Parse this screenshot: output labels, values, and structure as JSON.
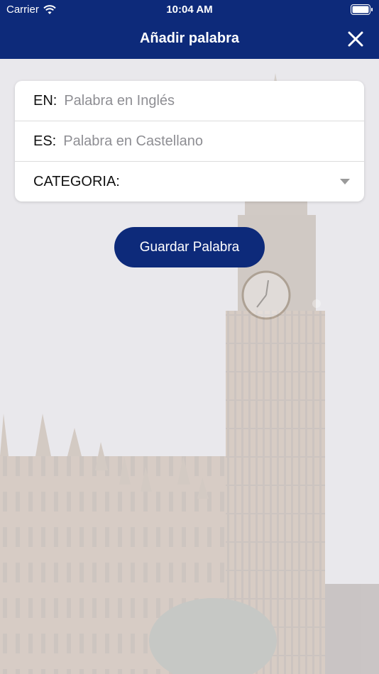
{
  "status_bar": {
    "carrier": "Carrier",
    "time": "10:04 AM",
    "wifi_icon": "wifi-icon",
    "battery_icon": "battery-icon"
  },
  "nav": {
    "title": "Añadir palabra",
    "close_icon": "close-icon"
  },
  "form": {
    "en": {
      "label": "EN:",
      "placeholder": "Palabra en Inglés",
      "value": ""
    },
    "es": {
      "label": "ES:",
      "placeholder": "Palabra en Castellano",
      "value": ""
    },
    "category": {
      "label": "CATEGORIA:",
      "value": "",
      "icon": "chevron-down-icon"
    }
  },
  "save_button": {
    "label": "Guardar Palabra"
  },
  "colors": {
    "primary": "#0d2a7a",
    "card": "#ffffff",
    "placeholder": "#8e8e93",
    "background_wash": "#e9e8ec"
  }
}
